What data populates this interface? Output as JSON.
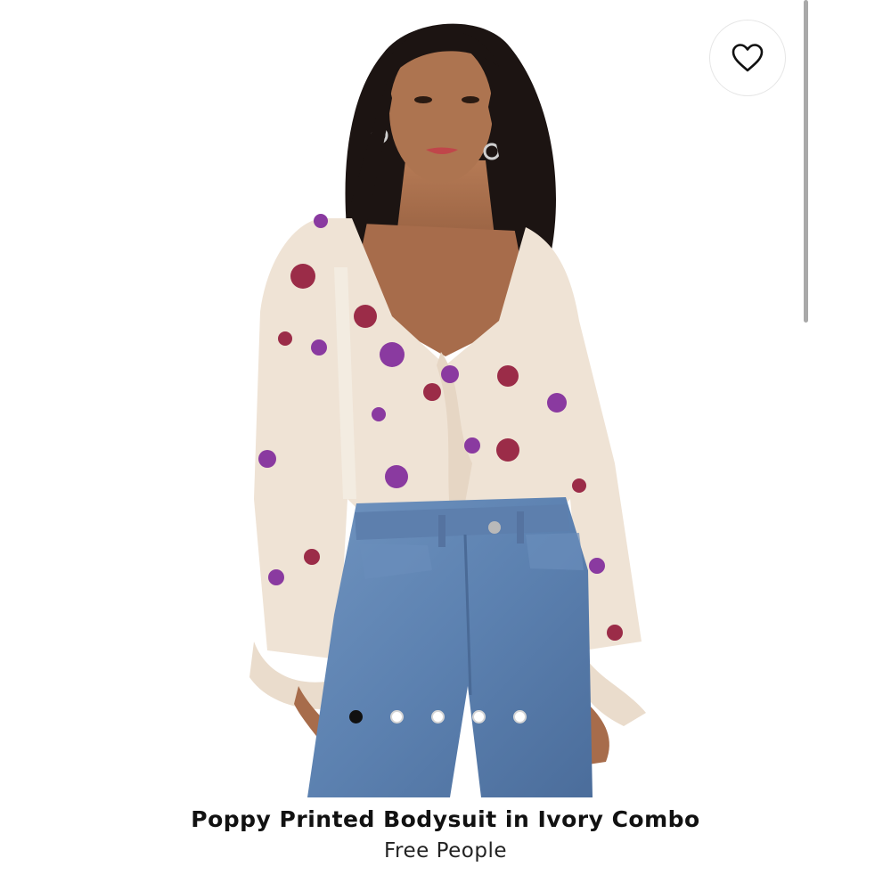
{
  "product": {
    "title": "Poppy Printed Bodysuit in Ivory Combo",
    "brand": "Free People"
  },
  "gallery": {
    "slide_count": 5,
    "active_index": 0
  },
  "favorite": {
    "icon": "heart-outline-icon"
  },
  "colors": {
    "background": "#ffffff",
    "active_dot": "#111111",
    "inactive_dot_border": "#d5d5d5",
    "scrollbar": "#a9a9a9"
  }
}
